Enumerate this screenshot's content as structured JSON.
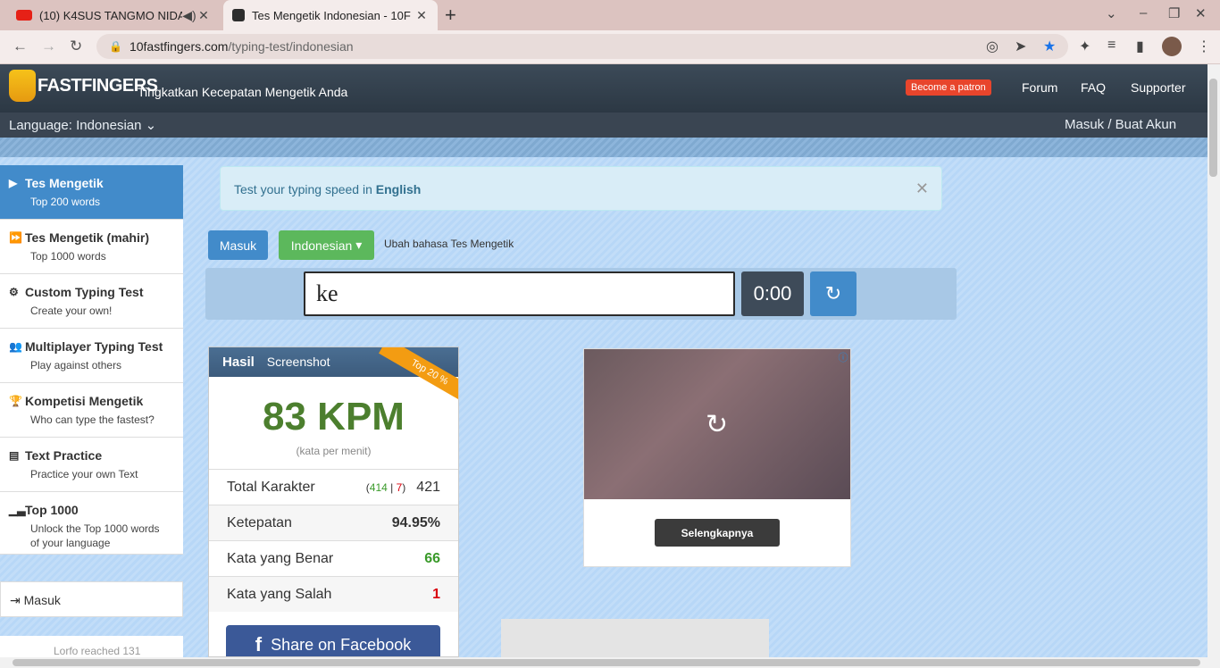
{
  "browser": {
    "tabs": [
      {
        "title": "(10) K4SUS TANGMO NIDA",
        "favicon_color": "#e62117"
      },
      {
        "title": "Tes Mengetik Indonesian - 10F",
        "favicon_color": "#2d2d2d"
      }
    ],
    "url_host": "10fastfingers.com",
    "url_path": "/typing-test/indonesian",
    "new_tab_label": "+"
  },
  "site": {
    "logo_text": "FASTFINGERS",
    "tagline": "Tingkatkan Kecepatan Mengetik Anda",
    "patron_label": "Become a patron",
    "nav": [
      "Forum",
      "FAQ",
      "Supporter"
    ],
    "language_label": "Language: Indonesian",
    "login_label": "Masuk / Buat Akun"
  },
  "sidebar": {
    "items": [
      {
        "title": "Tes Mengetik",
        "sub": "Top 200 words",
        "icon": "play-icon"
      },
      {
        "title": "Tes Mengetik (mahir)",
        "sub": "Top 1000 words",
        "icon": "fast-forward-icon"
      },
      {
        "title": "Custom Typing Test",
        "sub": "Create your own!",
        "icon": "gears-icon"
      },
      {
        "title": "Multiplayer Typing Test",
        "sub": "Play against others",
        "icon": "users-icon"
      },
      {
        "title": "Kompetisi Mengetik",
        "sub": "Who can type the fastest?",
        "icon": "trophy-icon"
      },
      {
        "title": "Text Practice",
        "sub": "Practice your own Text",
        "icon": "document-icon"
      },
      {
        "title": "Top 1000",
        "sub": "Unlock the Top 1000 words",
        "sub2": "of your language",
        "icon": "signal-icon"
      }
    ],
    "login": "Masuk",
    "teaser": "Lorfo reached 131"
  },
  "alert": {
    "prefix": "Test your typing speed in",
    "lang": "English"
  },
  "controls": {
    "masuk": "Masuk",
    "language": "Indonesian",
    "hint": "Ubah bahasa Tes Mengetik",
    "input_value": "ke",
    "timer": "0:00"
  },
  "results": {
    "tab_active": "Hasil",
    "tab_other": "Screenshot",
    "kpm": "83 KPM",
    "kpm_sub": "(kata per menit)",
    "ribbon": "Top 20 %",
    "rows": [
      {
        "label": "Total Karakter",
        "correct": "414",
        "wrong": "7",
        "value": "421"
      },
      {
        "label": "Ketepatan",
        "value": "94.95%"
      },
      {
        "label": "Kata yang Benar",
        "value": "66"
      },
      {
        "label": "Kata yang Salah",
        "value": "1"
      }
    ],
    "share": "Share on Facebook"
  },
  "ad": {
    "button": "Selengkapnya",
    "info": "ⓘ"
  },
  "colors": {
    "accent_blue": "#428bca",
    "green": "#5cb85c",
    "kpm_green": "#4c7f2e",
    "wrong_red": "#d9000d",
    "correct_green": "#3a9a2a"
  }
}
